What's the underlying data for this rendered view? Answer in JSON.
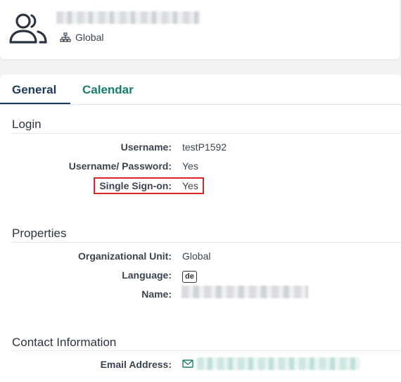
{
  "header": {
    "org_unit": "Global"
  },
  "tabs": [
    {
      "label": "General"
    },
    {
      "label": "Calendar"
    }
  ],
  "login": {
    "title": "Login",
    "username_label": "Username:",
    "username_value": "testP1592",
    "userpass_label": "Username/ Password:",
    "userpass_value": "Yes",
    "sso_label": "Single Sign-on:",
    "sso_value": "Yes"
  },
  "properties": {
    "title": "Properties",
    "ou_label": "Organizational Unit:",
    "ou_value": "Global",
    "language_label": "Language:",
    "language_value": "de",
    "name_label": "Name:"
  },
  "contact": {
    "title": "Contact Information",
    "email_label": "Email Address:"
  },
  "colors": {
    "primary": "#1f3a5c",
    "accent": "#1a7d6e",
    "highlight": "#d62828"
  },
  "icons": {
    "user": "users-icon",
    "org": "org-tree-icon",
    "email": "envelope-icon"
  }
}
